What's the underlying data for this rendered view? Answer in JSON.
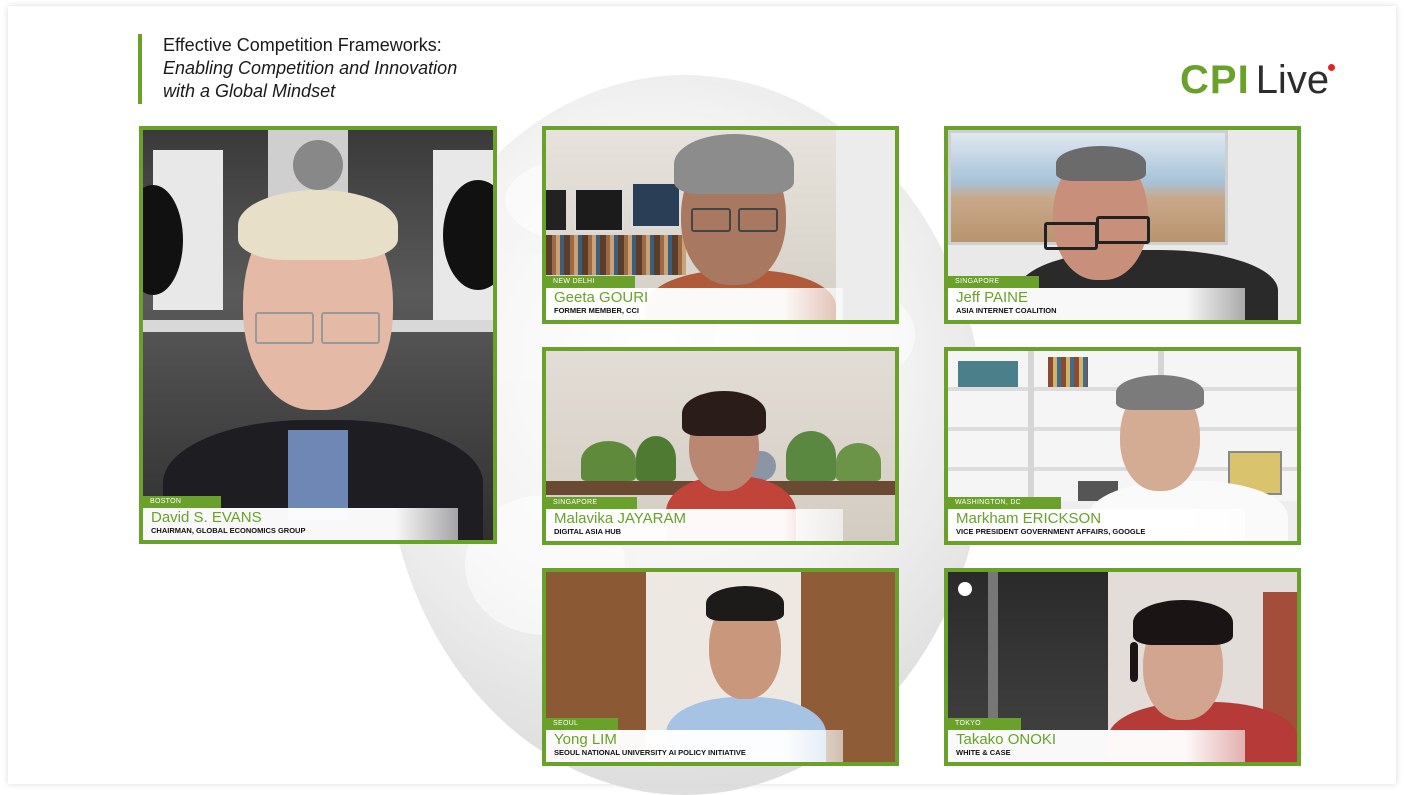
{
  "title": {
    "line1": "Effective Competition Frameworks:",
    "line2": "Enabling Competition and Innovation",
    "line3": "with a Global Mindset"
  },
  "logo": {
    "brand": "CPI",
    "suffix": "Live",
    "dot_color": "#d9262b"
  },
  "colors": {
    "accent": "#6aa12b"
  },
  "participants": [
    {
      "location": "BOSTON",
      "name": "David S. EVANS",
      "role": "CHAIRMAN, GLOBAL ECONOMICS GROUP"
    },
    {
      "location": "NEW DELHI",
      "name": "Geeta GOURI",
      "role": "FORMER MEMBER, CCI"
    },
    {
      "location": "SINGAPORE",
      "name": "Jeff PAINE",
      "role": "ASIA INTERNET COALITION"
    },
    {
      "location": "SINGAPORE",
      "name": "Malavika JAYARAM",
      "role": "DIGITAL ASIA HUB"
    },
    {
      "location": "WASHINGTON, DC",
      "name": "Markham ERICKSON",
      "role": "VICE PRESIDENT GOVERNMENT AFFAIRS, GOOGLE"
    },
    {
      "location": "SEOUL",
      "name": "Yong LIM",
      "role": "SEOUL NATIONAL UNIVERSITY AI POLICY INITIATIVE"
    },
    {
      "location": "TOKYO",
      "name": "Takako ONOKI",
      "role": "WHITE & CASE"
    }
  ]
}
